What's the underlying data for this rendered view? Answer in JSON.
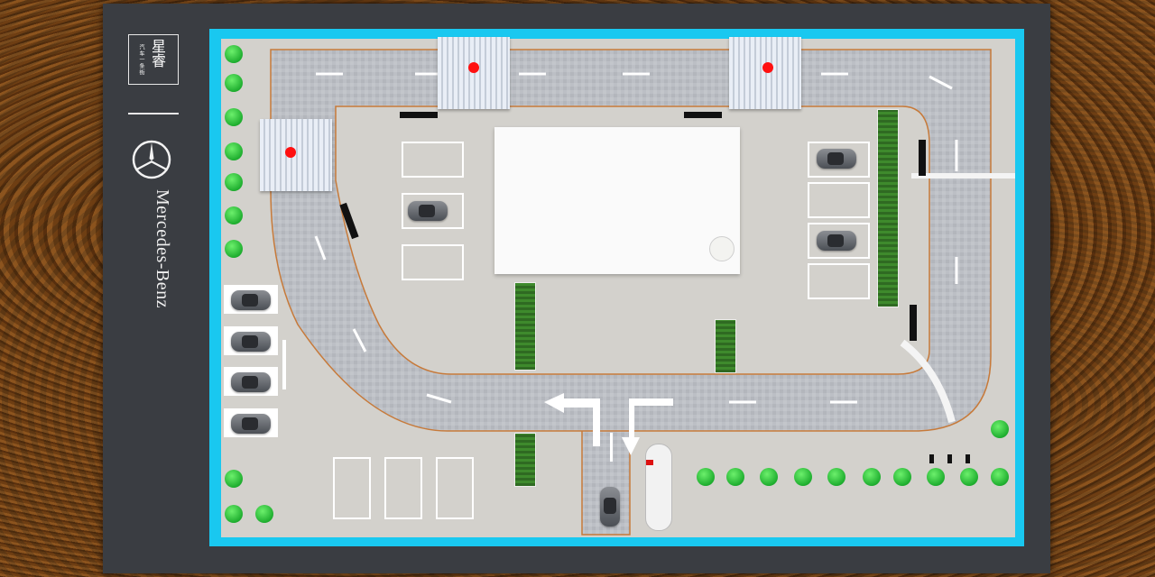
{
  "brand": {
    "logo_chinese": "星睿",
    "logo_subtext": "汽车一条街",
    "name": "Mercedes-Benz",
    "star_icon": "mercedes-star-icon"
  },
  "colors": {
    "site_border": "#19c8f0",
    "road": "#b9bcc2",
    "road_edge": "#c77a3a",
    "marker": "#ff1010",
    "tree": "#2fbf3a",
    "hedge": "#3a7a28"
  }
}
